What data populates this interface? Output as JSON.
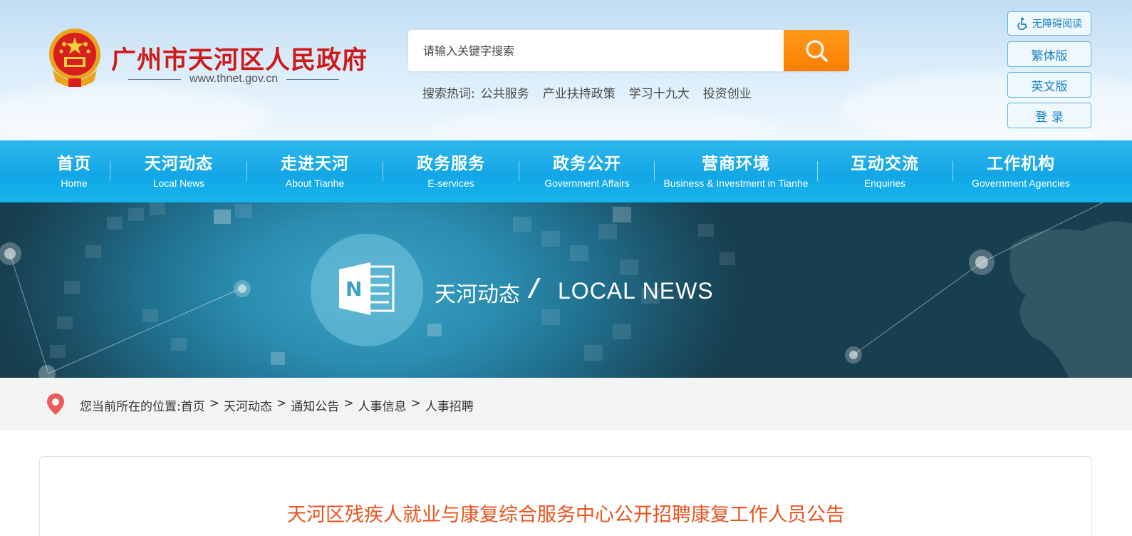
{
  "header": {
    "site_title": "广州市天河区人民政府",
    "site_url": "www.thnet.gov.cn",
    "emblem_icon": "national-emblem-icon"
  },
  "search": {
    "placeholder": "请输入关键字搜索",
    "value": "",
    "button_icon": "search-icon",
    "hot_label": "搜索热词:",
    "hot_words": [
      "公共服务",
      "产业扶持政策",
      "学习十九大",
      "投资创业"
    ]
  },
  "side_buttons": {
    "accessibility": "无障碍阅读",
    "traditional": "繁体版",
    "english": "英文版",
    "login": "登 录"
  },
  "nav": {
    "items": [
      {
        "zh": "首页",
        "en": "Home"
      },
      {
        "zh": "天河动态",
        "en": "Local News"
      },
      {
        "zh": "走进天河",
        "en": "About Tianhe"
      },
      {
        "zh": "政务服务",
        "en": "E-services"
      },
      {
        "zh": "政务公开",
        "en": "Government Affairs"
      },
      {
        "zh": "营商环境",
        "en": "Business & Investment in Tianhe"
      },
      {
        "zh": "互动交流",
        "en": "Enquiries"
      },
      {
        "zh": "工作机构",
        "en": "Government Agencies"
      }
    ]
  },
  "banner": {
    "icon": "news-notebook-icon",
    "title_zh": "天河动态",
    "slash": "/",
    "title_en": "LOCAL NEWS"
  },
  "breadcrumb": {
    "label": "您当前所在的位置:",
    "items": [
      "首页",
      "天河动态",
      "通知公告",
      "人事信息",
      "人事招聘"
    ],
    "separator": ">"
  },
  "article": {
    "title": "天河区残疾人就业与康复综合服务中心公开招聘康复工作人员公告"
  },
  "colors": {
    "title_red": "#cf1a1a",
    "search_orange": "#ff8a00",
    "nav_blue": "#13a6e6",
    "article_title": "#e9531e"
  }
}
